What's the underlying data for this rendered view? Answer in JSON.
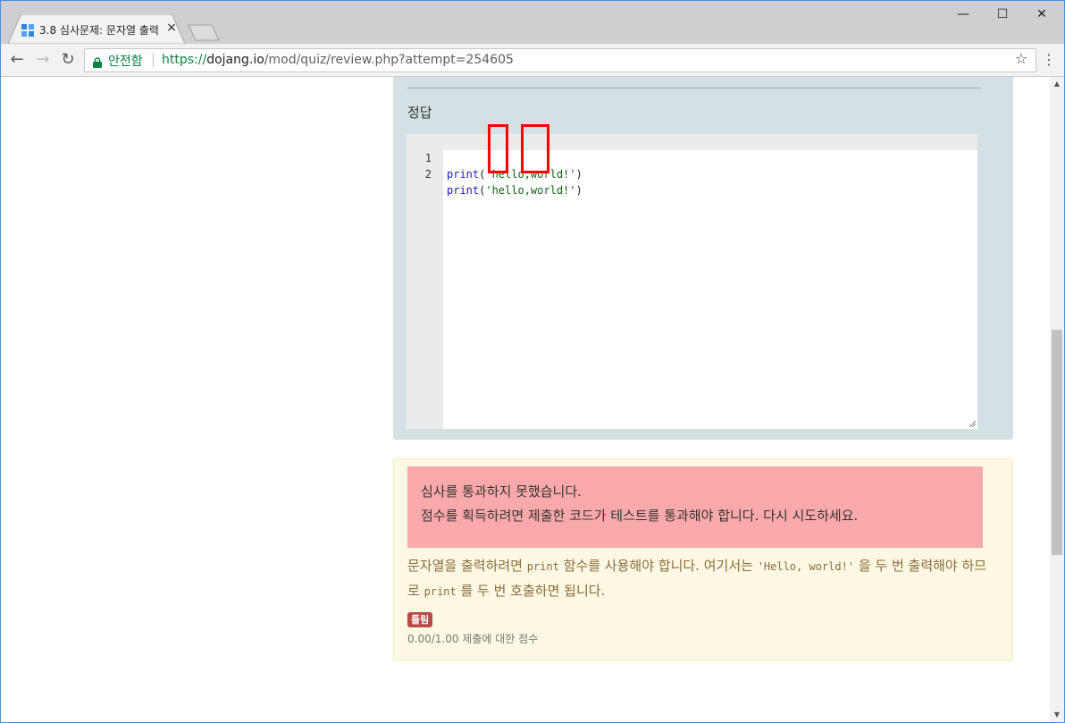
{
  "browser": {
    "tab_title": "3.8 심사문제: 문자열 출력",
    "tab_close": "×",
    "window_controls": [
      "—",
      "☐",
      "✕"
    ],
    "secure_label": "안전함",
    "url_scheme": "https://",
    "url_host": "dojang.io",
    "url_path": "/mod/quiz/review.php?attempt=254605",
    "nav": {
      "back": "←",
      "forward": "→",
      "reload": "↻"
    },
    "bookmark_star": "☆",
    "menu": "⋮"
  },
  "answer": {
    "heading": "정답",
    "lines": [
      {
        "number": "1",
        "keyword": "print",
        "open": "(",
        "string": "'hello,world!'",
        "close": ")"
      },
      {
        "number": "2",
        "keyword": "print",
        "open": "(",
        "string": "'hello,world!'",
        "close": ")"
      }
    ]
  },
  "feedback": {
    "alert_line1": "심사를 통과하지 못했습니다.",
    "alert_line2": "점수를 획득하려면 제출한 코드가 테스트를 통과해야 합니다. 다시 시도하세요.",
    "hint_part1": "문자열을 출력하려면 ",
    "hint_code1": "print",
    "hint_part2": " 함수를 사용해야 합니다. 여기서는 ",
    "hint_code2": "'Hello, world!'",
    "hint_part3": " 을 두 번 출력해야 하므로 ",
    "hint_code3": "print",
    "hint_part4": " 를 두 번 호출하면 됩니다.",
    "badge": "틀림",
    "score": "0.00/1.00 제출에 대한 점수"
  },
  "colors": {
    "highlight": "#ff0000",
    "secure": "#0b8043",
    "alert_bg": "#f9a9a9",
    "badge_bg": "#b94a48"
  }
}
